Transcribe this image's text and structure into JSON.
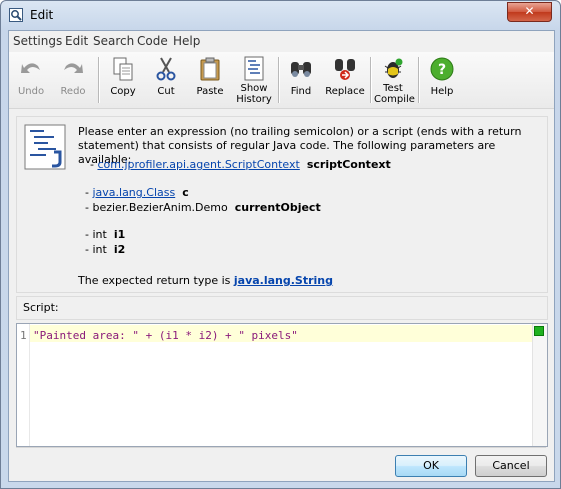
{
  "window": {
    "title": "Edit",
    "close_glyph": "✕"
  },
  "menu": [
    "Settings",
    "Edit",
    "Search",
    "Code",
    "Help"
  ],
  "toolbar": {
    "undo": "Undo",
    "redo": "Redo",
    "copy": "Copy",
    "cut": "Cut",
    "paste": "Paste",
    "show_history_1": "Show",
    "show_history_2": "History",
    "find": "Find",
    "replace": "Replace",
    "test_compile_1": "Test",
    "test_compile_2": "Compile",
    "help": "Help"
  },
  "info": {
    "description": "Please enter an expression (no trailing semicolon) or a script (ends with a return statement) that consists of regular Java code. The following parameters are available:",
    "params": [
      {
        "prefix": "- ",
        "type": "com.jprofiler.api.agent.ScriptContext",
        "type_is_link": true,
        "name": "scriptContext"
      },
      {
        "prefix": "- ",
        "type": "java.lang.Class",
        "type_is_link": true,
        "name": "c"
      },
      {
        "prefix": "- ",
        "type": "bezier.BezierAnim.Demo",
        "type_is_link": false,
        "name": "currentObject"
      },
      {
        "prefix": "- ",
        "type": "int",
        "type_is_link": false,
        "name": "i1"
      },
      {
        "prefix": "- ",
        "type": "int",
        "type_is_link": false,
        "name": "i2"
      }
    ],
    "return_prefix": "The expected return type is ",
    "return_type": "java.lang.String"
  },
  "script": {
    "label": "Script:",
    "line_number": "1",
    "code_part1": "\"Painted area: \"",
    "code_part2": " + (i1 * i2) + ",
    "code_part3": "\" pixels\""
  },
  "buttons": {
    "ok": "OK",
    "cancel": "Cancel"
  },
  "colors": {
    "link": "#0645ad",
    "string": "#8a1a7a",
    "status_ok": "#1fb11f"
  }
}
